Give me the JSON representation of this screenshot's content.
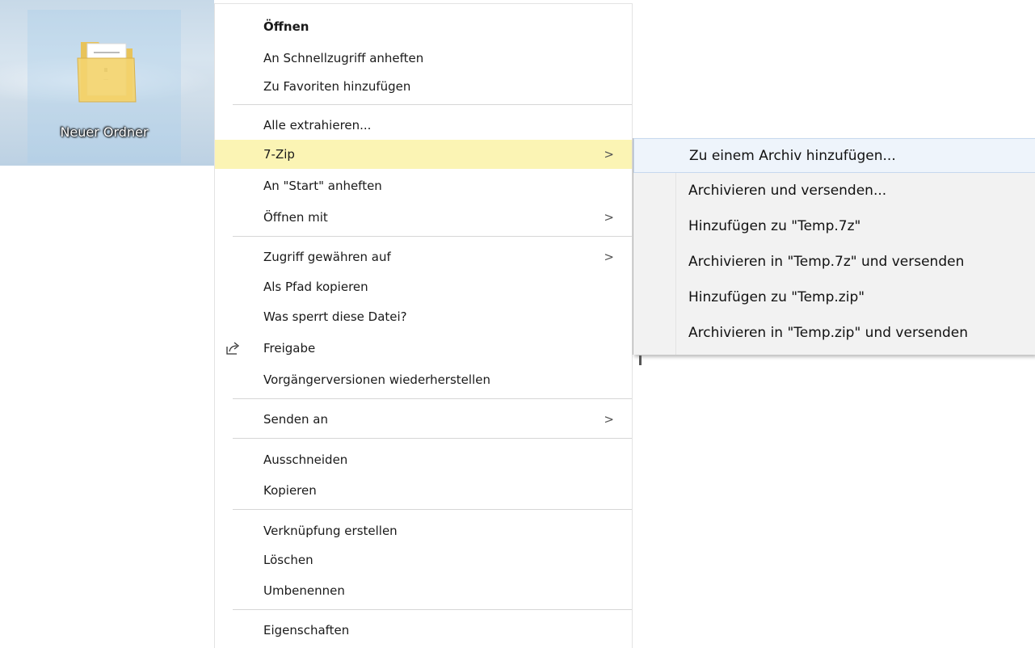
{
  "desktop": {
    "folder_label": "Neuer Ordner",
    "icon": "folder-icon"
  },
  "context_menu": {
    "items": [
      {
        "label": "Öffnen",
        "bold": true
      },
      {
        "label": "An Schnellzugriff anheften"
      },
      {
        "label": "Zu Favoriten hinzufügen"
      },
      {
        "label": "Alle extrahieren..."
      },
      {
        "label": "7-Zip",
        "submenu": true,
        "highlighted": true
      },
      {
        "label": "An \"Start\" anheften"
      },
      {
        "label": "Öffnen mit",
        "submenu": true
      },
      {
        "label": "Zugriff gewähren auf",
        "submenu": true
      },
      {
        "label": "Als Pfad kopieren"
      },
      {
        "label": "Was sperrt diese Datei?"
      },
      {
        "label": "Freigabe",
        "icon": "share-icon"
      },
      {
        "label": "Vorgängerversionen wiederherstellen"
      },
      {
        "label": "Senden an",
        "submenu": true
      },
      {
        "label": "Ausschneiden"
      },
      {
        "label": "Kopieren"
      },
      {
        "label": "Verknüpfung erstellen"
      },
      {
        "label": "Löschen"
      },
      {
        "label": "Umbenennen"
      },
      {
        "label": "Eigenschaften"
      }
    ],
    "submenu_arrow": ">",
    "highlight_color": "#fbf4b4"
  },
  "submenu_7zip": {
    "items": [
      {
        "label": "Zu einem Archiv hinzufügen...",
        "hovered": true
      },
      {
        "label": "Archivieren und versenden..."
      },
      {
        "label": "Hinzufügen zu \"Temp.7z\""
      },
      {
        "label": "Archivieren in \"Temp.7z\" und versenden"
      },
      {
        "label": "Hinzufügen zu \"Temp.zip\""
      },
      {
        "label": "Archivieren in \"Temp.zip\" und versenden"
      }
    ]
  }
}
